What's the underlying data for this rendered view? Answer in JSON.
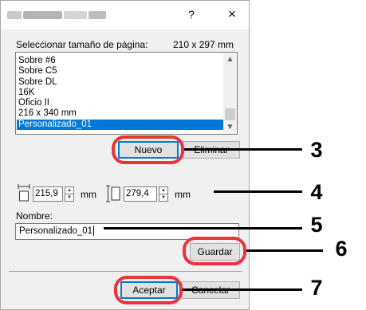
{
  "titlebar": {
    "help_label": "?",
    "close_label": "×"
  },
  "list_section": {
    "label": "Seleccionar tamaño de página:",
    "size_readout": "210 x 297 mm",
    "items": [
      {
        "label": "Sobre #6",
        "selected": false
      },
      {
        "label": "Sobre C5",
        "selected": false
      },
      {
        "label": "Sobre DL",
        "selected": false
      },
      {
        "label": "16K",
        "selected": false
      },
      {
        "label": "Oficio II",
        "selected": false
      },
      {
        "label": "216 x 340 mm",
        "selected": false
      },
      {
        "label": "Personalizado_01",
        "selected": true
      }
    ],
    "scroll_up": "▲",
    "scroll_down": "▼"
  },
  "buttons": {
    "nuevo": "Nuevo",
    "eliminar": "Eliminar",
    "guardar": "Guardar",
    "aceptar": "Aceptar",
    "cancelar": "Cancelar"
  },
  "dimensions": {
    "width_value": "215,9",
    "width_unit": "mm",
    "height_value": "279,4",
    "height_unit": "mm",
    "spin_up": "▲",
    "spin_down": "▼"
  },
  "name_section": {
    "label": "Nombre:",
    "value": "Personalizado_01"
  },
  "callouts": [
    "3",
    "4",
    "5",
    "6",
    "7"
  ],
  "colors": {
    "highlight_red": "#e8343a",
    "selection_blue": "#0078d7",
    "dialog_bg": "#f0f0f0"
  }
}
